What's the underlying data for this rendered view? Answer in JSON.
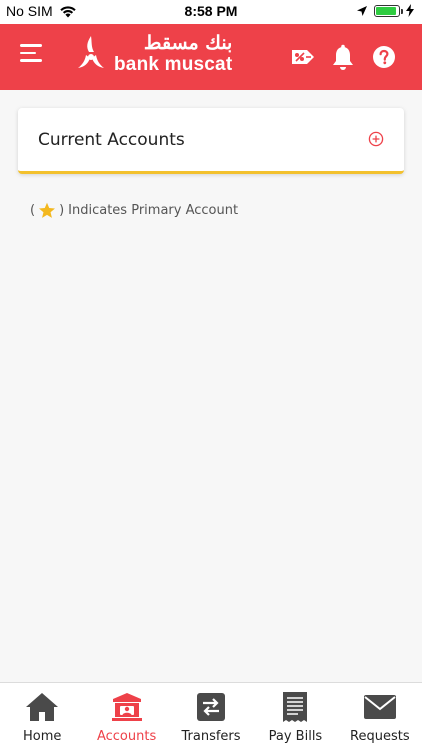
{
  "status_bar": {
    "carrier": "No SIM",
    "time": "8:58 PM"
  },
  "header": {
    "logo_arabic": "بنك مسقط",
    "logo_latin": "bank muscat"
  },
  "accounts_section": {
    "title": "Current Accounts"
  },
  "primary_note": {
    "open": "(",
    "close": ")",
    "text": "Indicates Primary Account"
  },
  "bottom_nav": {
    "items": [
      {
        "label": "Home"
      },
      {
        "label": "Accounts"
      },
      {
        "label": "Transfers"
      },
      {
        "label": "Pay Bills"
      },
      {
        "label": "Requests"
      }
    ],
    "active_index": 1
  },
  "colors": {
    "brand_red": "#ee4149",
    "accent_yellow": "#f3c12e",
    "icon_gray": "#555555",
    "battery_green": "#2ecc40"
  }
}
